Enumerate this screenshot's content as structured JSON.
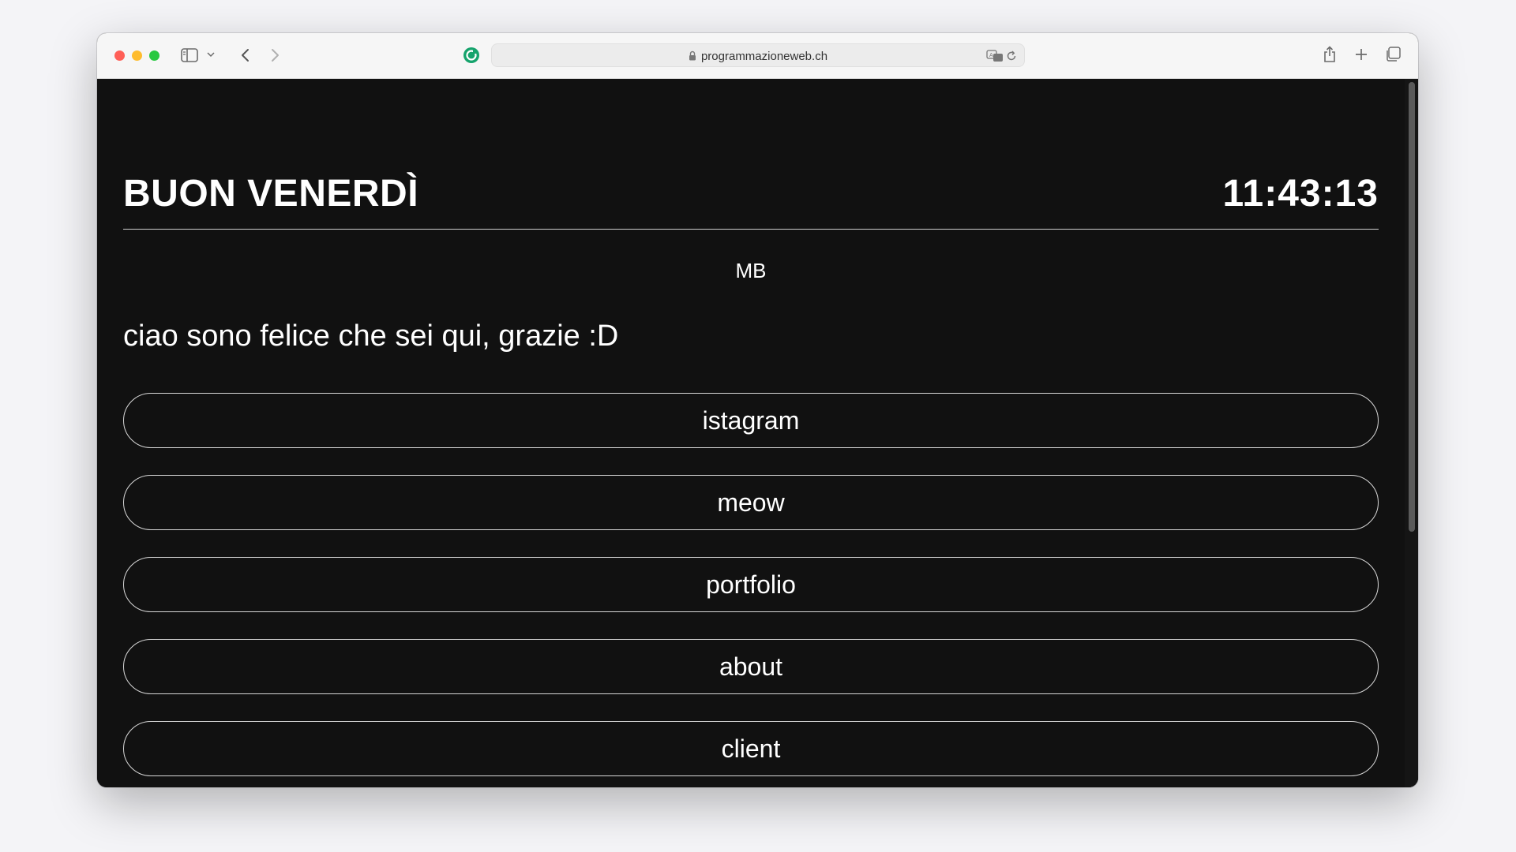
{
  "browser": {
    "url": "programmazioneweb.ch",
    "traffic_colors": {
      "close": "#ff5f57",
      "minimize": "#febc2e",
      "zoom": "#28c840"
    },
    "extension_color": "#15a36c",
    "icons": [
      "sidebar-toggle-icon",
      "chevron-down-icon",
      "back-arrow-icon",
      "forward-arrow-icon",
      "extension-icon",
      "lock-icon",
      "translate-icon",
      "reload-icon",
      "share-icon",
      "new-tab-icon",
      "tab-overview-icon"
    ]
  },
  "page": {
    "greeting": "BUON VENERDÌ",
    "clock": "11:43:13",
    "initials": "MB",
    "tagline": "ciao sono felice che sei qui, grazie :D",
    "links": [
      "istagram",
      "meow",
      "portfolio",
      "about",
      "client"
    ],
    "background_color": "#111111",
    "text_color": "#ffffff",
    "border_color": "#d8d8d8"
  }
}
